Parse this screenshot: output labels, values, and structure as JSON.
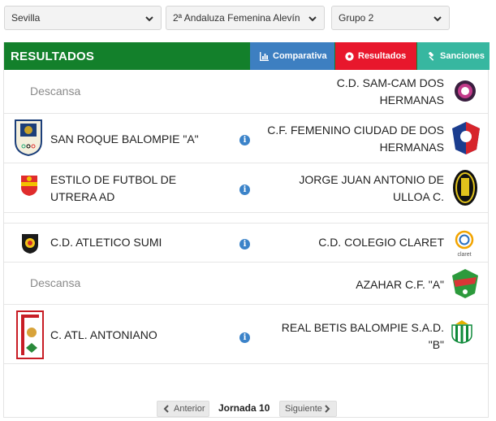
{
  "filters": {
    "province": "Sevilla",
    "competition": "2ª Andaluza Femenina Alevín",
    "group": "Grupo 2"
  },
  "panel": {
    "title": "RESULTADOS",
    "tabs": {
      "comparativa": "Comparativa",
      "resultados": "Resultados",
      "sanciones": "Sanciones"
    }
  },
  "matches": [
    {
      "home": "Descansa",
      "away": "C.D. SAM-CAM DOS HERMANAS",
      "rest": true
    },
    {
      "home": "SAN ROQUE BALOMPIE \"A\"",
      "away": "C.F. FEMENINO CIUDAD DE DOS HERMANAS",
      "rest": false
    },
    {
      "home": "ESTILO DE FUTBOL DE UTRERA AD",
      "away": "JORGE JUAN ANTONIO DE ULLOA C.",
      "rest": false
    },
    {
      "home": "C.D. ATLETICO SUMI",
      "away": "C.D. COLEGIO CLARET",
      "rest": false
    },
    {
      "home": "Descansa",
      "away": "AZAHAR C.F. \"A\"",
      "rest": true
    },
    {
      "home": "C. ATL. ANTONIANO",
      "away": "REAL BETIS BALOMPIE S.A.D. \"B\"",
      "rest": false
    }
  ],
  "crest_text": {
    "claret": "claret"
  },
  "pager": {
    "prev": "Anterior",
    "label": "Jornada 10",
    "next": "Siguiente"
  },
  "colors": {
    "header_green": "#13802b",
    "comparativa_blue": "#3d7fc1",
    "resultados_red": "#e8172c",
    "sanciones_teal": "#37b7a0",
    "info_blue": "#3b83c9"
  },
  "icons": [
    "chevron-down-icon",
    "bar-chart-icon",
    "soccer-ball-icon",
    "gavel-icon",
    "info-icon",
    "chevron-left-icon",
    "chevron-right-icon"
  ]
}
